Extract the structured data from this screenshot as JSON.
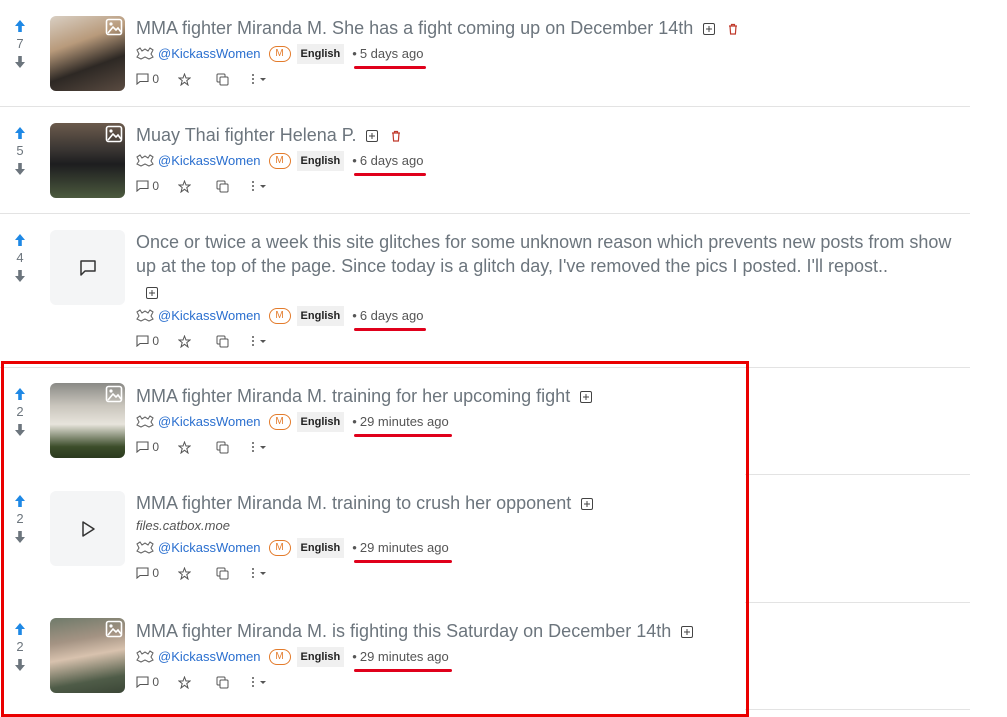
{
  "posts": [
    {
      "score": "7",
      "thumb": "photo",
      "title": "MMA fighter Miranda M. She has a fight coming up on December 14th",
      "show_delete": true,
      "user": "@KickassWomen",
      "badge": "M",
      "language": "English",
      "time": "5 days ago",
      "underline": true,
      "comments": "0",
      "url": ""
    },
    {
      "score": "5",
      "thumb": "photo",
      "title": "Muay Thai fighter Helena P.",
      "show_delete": true,
      "user": "@KickassWomen",
      "badge": "M",
      "language": "English",
      "time": "6 days ago",
      "underline": true,
      "comments": "0",
      "url": ""
    },
    {
      "score": "4",
      "thumb": "text",
      "title": "Once or twice a week this site glitches for some unknown reason which prevents new posts from show up at the top of the page. Since today is a glitch day, I've removed the pics I posted. I'll repost..",
      "show_delete": false,
      "user": "@KickassWomen",
      "badge": "M",
      "language": "English",
      "time": "6 days ago",
      "underline": true,
      "comments": "0",
      "url": ""
    },
    {
      "score": "2",
      "thumb": "photo",
      "title": "MMA fighter Miranda M. training for her upcoming fight",
      "show_delete": false,
      "user": "@KickassWomen",
      "badge": "M",
      "language": "English",
      "time": "29 minutes ago",
      "underline": true,
      "comments": "0",
      "url": ""
    },
    {
      "score": "2",
      "thumb": "video",
      "title": "MMA fighter Miranda M. training to crush her opponent",
      "show_delete": false,
      "user": "@KickassWomen",
      "badge": "M",
      "language": "English",
      "time": "29 minutes ago",
      "underline": true,
      "comments": "0",
      "url": "files.catbox.moe"
    },
    {
      "score": "2",
      "thumb": "photo",
      "title": "MMA fighter Miranda M. is fighting this Saturday on December 14th",
      "show_delete": false,
      "user": "@KickassWomen",
      "badge": "M",
      "language": "English",
      "time": "29 minutes ago",
      "underline": true,
      "comments": "0",
      "url": ""
    }
  ],
  "colors": {
    "upvote": "#1e88e5",
    "downvote": "#6c757d",
    "annotation": "#ea0000",
    "user_link": "#2a6fcf",
    "badge": "#e37b2b",
    "delete": "#c0392b"
  },
  "icons": {
    "upvote": "arrow-up-icon",
    "downvote": "arrow-down-icon",
    "image": "image-icon",
    "expand": "plus-square-icon",
    "delete": "trash-icon",
    "community": "community-icon",
    "comment": "comment-icon",
    "star": "star-icon",
    "copy": "copy-icon",
    "more": "more-icon",
    "text_post": "message-square-icon",
    "video": "play-icon"
  }
}
